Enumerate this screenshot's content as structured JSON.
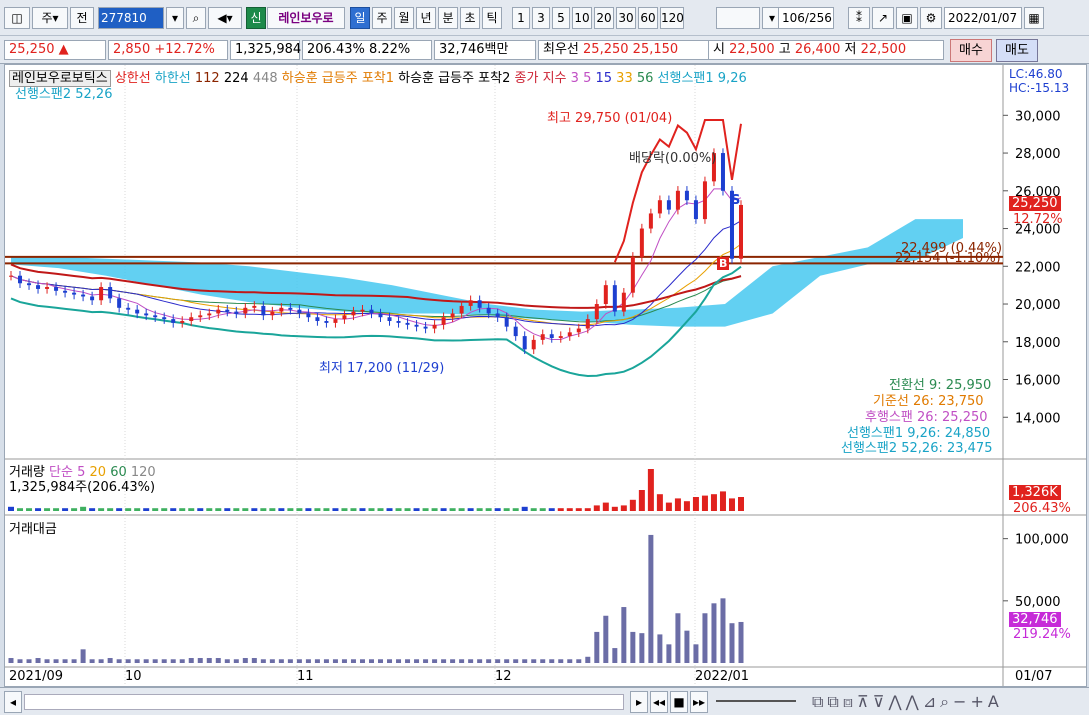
{
  "toolbar": {
    "type_label": "주",
    "period_label": "전",
    "code": "277810",
    "new_label": "신",
    "stock_name": "레인보우로",
    "periods": [
      "일",
      "주",
      "월",
      "년",
      "분",
      "초",
      "틱"
    ],
    "intervals": [
      "1",
      "3",
      "5",
      "10",
      "20",
      "30",
      "60",
      "120"
    ],
    "page_count": "106",
    "page_total": "/256",
    "date": "2022/01/07"
  },
  "quote": {
    "price": "25,250 ▲",
    "change": "2,850",
    "change_pct": "+12.72%",
    "volume": "1,325,984",
    "vol_ratio": "206.43%",
    "turnover": "8.22%",
    "amount": "32,746백만",
    "best_label": "최우선",
    "ask": "25,250",
    "bid": "25,150",
    "open_label": "시",
    "open": "22,500",
    "high_label": "고",
    "high": "26,400",
    "low_label": "저",
    "low": "22,500",
    "buy_label": "매수",
    "sell_label": "매도"
  },
  "main_chart": {
    "legend": {
      "name": "레인보우로보틱스",
      "upper": "상한선",
      "lower": "하한선",
      "ma": [
        "112",
        "224",
        "448"
      ],
      "ind1": "하승훈 급등주 포착1",
      "ind2": "하승훈 급등주 포착2",
      "close_label": "종가 지수",
      "ma2": [
        "3",
        "5",
        "15",
        "33",
        "56"
      ],
      "span1": "선행스팬1 9,26",
      "span2": "선행스팬2 52,26"
    },
    "lc": "LC:46.80",
    "hc": "HC:-15.13",
    "y_ticks": [
      "30,000",
      "28,000",
      "26,000",
      "24,000",
      "22,000",
      "20,000",
      "18,000",
      "16,000",
      "14,000"
    ],
    "current_price": "25,250",
    "current_pct": "12.72%",
    "line1": "22,499 (0.44%)",
    "line2": "22,154 (-1.10%)",
    "high_anno": "최고 29,750 (01/04)",
    "low_anno": "최저 17,200 (11/29)",
    "dividend": "배당락(0.00%)",
    "sig_s": "S",
    "sig_b": "B",
    "ichimoku": {
      "conversion": "전환선 9: 25,950",
      "base": "기준선 26: 23,750",
      "lagging": "후행스팬 26: 25,250",
      "span1": "선행스팬1 9,26: 24,850",
      "span2": "선행스팬2 52,26: 23,475"
    }
  },
  "volume_panel": {
    "title": "거래량",
    "ma_label": "단순",
    "ma": [
      "5",
      "20",
      "60",
      "120"
    ],
    "value": "1,325,984주(206.43%)",
    "tag": "1,326K",
    "tag_pct": "206.43%",
    "y_tick": "1,326K"
  },
  "amount_panel": {
    "title": "거래대금",
    "y_ticks": [
      "100,000",
      "50,000"
    ],
    "tag": "32,746",
    "tag_pct": "219.24%"
  },
  "x_axis": {
    "labels": [
      "2021/09",
      "10",
      "11",
      "12",
      "2022/01"
    ],
    "right": "01/07"
  },
  "chart_data": {
    "type": "candlestick",
    "title": "레인보우로보틱스",
    "closes": [
      21500,
      21100,
      21000,
      20800,
      20900,
      20700,
      20600,
      20500,
      20400,
      20200,
      20900,
      20300,
      19800,
      19700,
      19500,
      19400,
      19300,
      19200,
      19000,
      19100,
      19300,
      19400,
      19500,
      19700,
      19600,
      19500,
      19800,
      19900,
      19400,
      19600,
      19800,
      19700,
      19500,
      19300,
      19100,
      19000,
      19200,
      19400,
      19600,
      19700,
      19500,
      19300,
      19100,
      19000,
      18900,
      18800,
      18700,
      18900,
      19300,
      19500,
      19900,
      20200,
      19800,
      19500,
      19300,
      18800,
      18300,
      17600,
      18100,
      18400,
      18200,
      18300,
      18500,
      18700,
      19200,
      20000,
      21000,
      19600,
      20600,
      22500,
      24000,
      24800,
      25500,
      25000,
      26000,
      25500,
      24500,
      26500,
      28000,
      26000,
      22400,
      25250
    ],
    "volumes": [
      3,
      2,
      2,
      2,
      2,
      2,
      2,
      2,
      3,
      2,
      2,
      2,
      2,
      2,
      2,
      2,
      2,
      2,
      2,
      2,
      2,
      2,
      2,
      2,
      2,
      2,
      2,
      2,
      2,
      2,
      2,
      2,
      2,
      2,
      2,
      2,
      2,
      2,
      2,
      2,
      2,
      2,
      2,
      2,
      2,
      2,
      2,
      2,
      2,
      2,
      2,
      2,
      2,
      2,
      2,
      2,
      2,
      3,
      2,
      2,
      2,
      2,
      2,
      2,
      2,
      4,
      6,
      3,
      4,
      8,
      15,
      30,
      12,
      6,
      9,
      7,
      10,
      11,
      12,
      14,
      9,
      10
    ],
    "amounts": [
      4,
      3,
      3,
      4,
      3,
      3,
      3,
      3,
      11,
      3,
      3,
      4,
      3,
      3,
      3,
      3,
      3,
      3,
      3,
      3,
      4,
      4,
      4,
      4,
      3,
      3,
      4,
      4,
      3,
      3,
      3,
      3,
      3,
      3,
      3,
      3,
      3,
      3,
      3,
      3,
      3,
      3,
      3,
      3,
      3,
      3,
      3,
      3,
      3,
      3,
      3,
      3,
      3,
      3,
      3,
      3,
      3,
      3,
      3,
      3,
      3,
      3,
      3,
      3,
      5,
      25,
      38,
      12,
      45,
      25,
      24,
      103,
      23,
      15,
      40,
      26,
      15,
      40,
      48,
      52,
      32,
      33
    ],
    "ylim": [
      12000,
      31500
    ],
    "amount_ylim": [
      0,
      115000
    ]
  }
}
